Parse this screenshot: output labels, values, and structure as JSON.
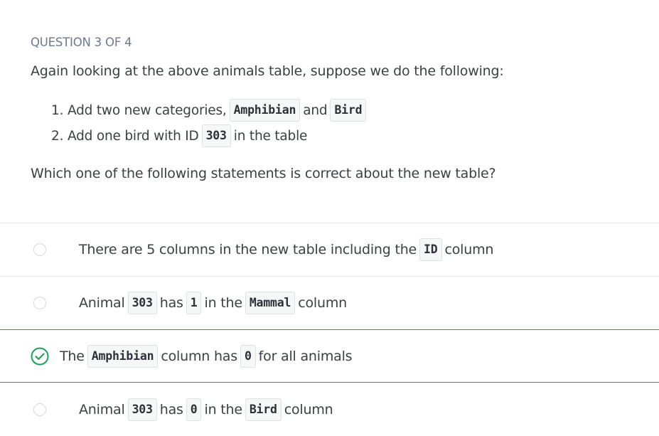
{
  "question_header": "QUESTION 3 OF 4",
  "prompt": "Again looking at the above animals table, suppose we do the following:",
  "steps": [
    {
      "num": "1.",
      "t1": "Add two new categories,",
      "c1": "Amphibian",
      "t2": "and",
      "c2": "Bird"
    },
    {
      "num": "2.",
      "t1": "Add one bird with ID",
      "c1": "303",
      "t2": "in the table"
    }
  ],
  "question": "Which one of the following statements is correct about the new table?",
  "options": [
    {
      "t1": "There are 5 columns in the new table including the",
      "c1": "ID",
      "t2": "column",
      "selected": false
    },
    {
      "t1": "Animal",
      "c1": "303",
      "t2": "has",
      "c2": "1",
      "t3": "in the",
      "c3": "Mammal",
      "t4": "column",
      "selected": false
    },
    {
      "t1": "The",
      "c1": "Amphibian",
      "t2": "column has",
      "c2": "0",
      "t3": "for all animals",
      "selected": true,
      "correct": true
    },
    {
      "t1": "Animal",
      "c1": "303",
      "t2": "has",
      "c2": "0",
      "t3": "in the",
      "c3": "Bird",
      "t4": "column",
      "selected": false
    }
  ],
  "colors": {
    "correct": "#20a15a",
    "header": "#6b7a8c",
    "text": "#3c4043"
  },
  "icons": {
    "correct": "check-circle-icon",
    "unselected": "radio-icon"
  }
}
